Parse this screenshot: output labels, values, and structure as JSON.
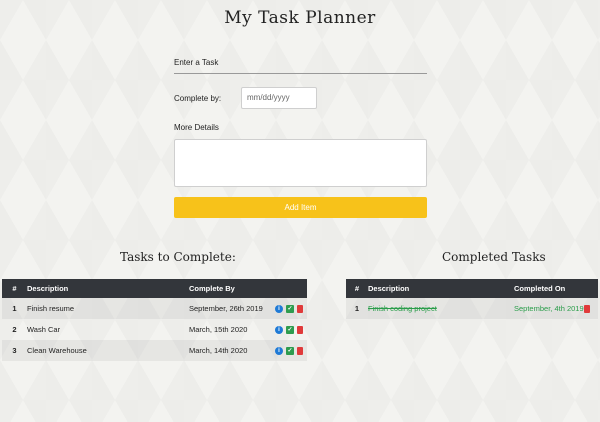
{
  "page": {
    "title": "My Task Planner"
  },
  "form": {
    "task_placeholder": "Enter a Task",
    "complete_by_label": "Complete by:",
    "date_placeholder": "mm/dd/yyyy",
    "details_label": "More Details",
    "add_button": "Add Item"
  },
  "todo": {
    "heading": "Tasks to Complete:",
    "columns": [
      "#",
      "Description",
      "Complete By"
    ],
    "rows": [
      {
        "num": "1",
        "description": "Finish resume",
        "date": "September, 26th 2019"
      },
      {
        "num": "2",
        "description": "Wash Car",
        "date": "March, 15th 2020"
      },
      {
        "num": "3",
        "description": "Clean Warehouse",
        "date": "March, 14th 2020"
      }
    ]
  },
  "completed": {
    "heading": "Completed Tasks",
    "columns": [
      "#",
      "Description",
      "Completed On"
    ],
    "rows": [
      {
        "num": "1",
        "description": "Finish coding project",
        "date": "September, 4th 2019"
      }
    ]
  },
  "icons": {
    "info": "info-icon",
    "check": "check-icon",
    "trash": "trash-icon"
  },
  "colors": {
    "accent": "#f7c21a",
    "header_bg": "#33363b",
    "completed_text": "#2a9d4a",
    "info": "#1f7ad6",
    "check": "#2e9c4f",
    "trash": "#e03a3a"
  }
}
